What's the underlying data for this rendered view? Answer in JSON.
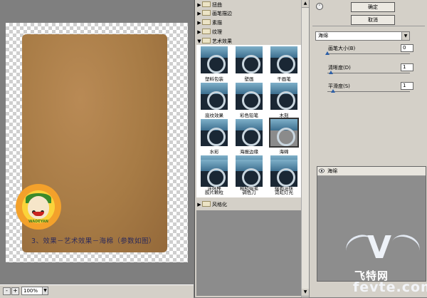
{
  "preview": {
    "caption": "3、效果－艺术效果－海棉（参数如图）",
    "logo_text": "WADEYAN",
    "zoom": "100%",
    "zoom_minus": "-",
    "zoom_plus": "+"
  },
  "gallery": {
    "categories": [
      {
        "label": "扭曲",
        "expanded": false
      },
      {
        "label": "画笔描边",
        "expanded": false
      },
      {
        "label": "素描",
        "expanded": false
      },
      {
        "label": "纹理",
        "expanded": false
      },
      {
        "label": "艺术效果",
        "expanded": true
      }
    ],
    "thumbnails": [
      {
        "label": "塑料包装"
      },
      {
        "label": "壁画"
      },
      {
        "label": "干画笔"
      },
      {
        "label": "底纹效果"
      },
      {
        "label": "彩色铅笔"
      },
      {
        "label": "木刻"
      },
      {
        "label": "水彩"
      },
      {
        "label": "海报边缘"
      },
      {
        "label": "海绵"
      },
      {
        "label": "涂抹棒"
      },
      {
        "label": "粗糙蜡笔"
      },
      {
        "label": "绘画涂抹"
      },
      {
        "label": "胶片颗粒"
      },
      {
        "label": "调色刀"
      },
      {
        "label": "霓虹灯光"
      }
    ],
    "selected_index": 8,
    "bottom_category": {
      "label": "风格化",
      "expanded": false
    }
  },
  "panel": {
    "ok_label": "确定",
    "cancel_label": "取消",
    "filter_select": "海绵",
    "params": [
      {
        "label": "画笔大小(B)",
        "value": "0",
        "level": 0.0
      },
      {
        "label": "清晰度(D)",
        "value": "1",
        "level": 0.04
      },
      {
        "label": "平滑度(S)",
        "value": "1",
        "level": 0.07
      }
    ],
    "effect_layer": "海绵"
  },
  "watermark": {
    "mark": "V",
    "cn": "飞特网",
    "en": "fevte.com"
  },
  "colors": {
    "selection_knob": "#2b5ea7",
    "photo": "#a77b45"
  }
}
